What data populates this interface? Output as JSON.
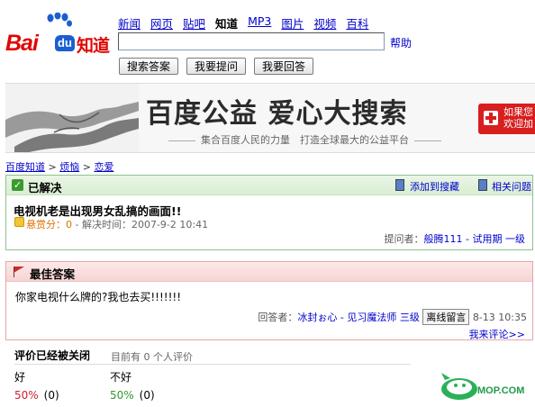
{
  "header": {
    "logo_text": "Bai du 知道",
    "nav": [
      "新闻",
      "网页",
      "贴吧",
      "知道",
      "MP3",
      "图片",
      "视频",
      "百科"
    ],
    "nav_active": "知道",
    "search_value": "",
    "help_label": "帮助",
    "buttons": [
      "搜索答案",
      "我要提问",
      "我要回答"
    ]
  },
  "banner": {
    "title": "百度公益 爱心大搜索",
    "subtitle": "集合百度人民的力量　打造全球最大的公益平台",
    "ad_text_1": "如果您",
    "ad_text_2": "欢迎加"
  },
  "breadcrumb": {
    "items": [
      "百度知道",
      "烦恼",
      "恋爱"
    ],
    "separator": " > "
  },
  "question": {
    "status": "已解决",
    "add_favorite": "添加到搜藏",
    "related": "相关问题",
    "title": "电视机老是出现男女乱搞的画面!!",
    "reward_label": "悬赏分：0",
    "solve_time": " - 解决时间：2007-9-2 10:41",
    "asker_label": "提问者：",
    "asker_name": "般腾111",
    "asker_level": " - 试用期 一级"
  },
  "answer": {
    "header": "最佳答案",
    "text": "你家电视什么牌的?我也去买!!!!!!!",
    "answerer_label": "回答者：",
    "answerer_name": "冰封ぉ心",
    "answerer_level": " - 见习魔法师 三级",
    "message_button": "离线留言",
    "time": "8-13 10:35",
    "comment_link": "我来评论>>"
  },
  "rating": {
    "header": "评价已经被关闭",
    "count_text": "目前有 0 个人评价",
    "good_label": "好",
    "bad_label": "不好",
    "good_percent": "50%",
    "good_count": "(0)",
    "bad_percent": "50%",
    "bad_count": "(0)"
  },
  "watermark": {
    "text": "MOP.COM"
  },
  "colors": {
    "brand_red": "#e10602",
    "brand_blue": "#1a5fd0",
    "link_blue": "#0000cc",
    "solved_green": "#3a9b2e",
    "best_answer_red": "#c82b2b"
  }
}
